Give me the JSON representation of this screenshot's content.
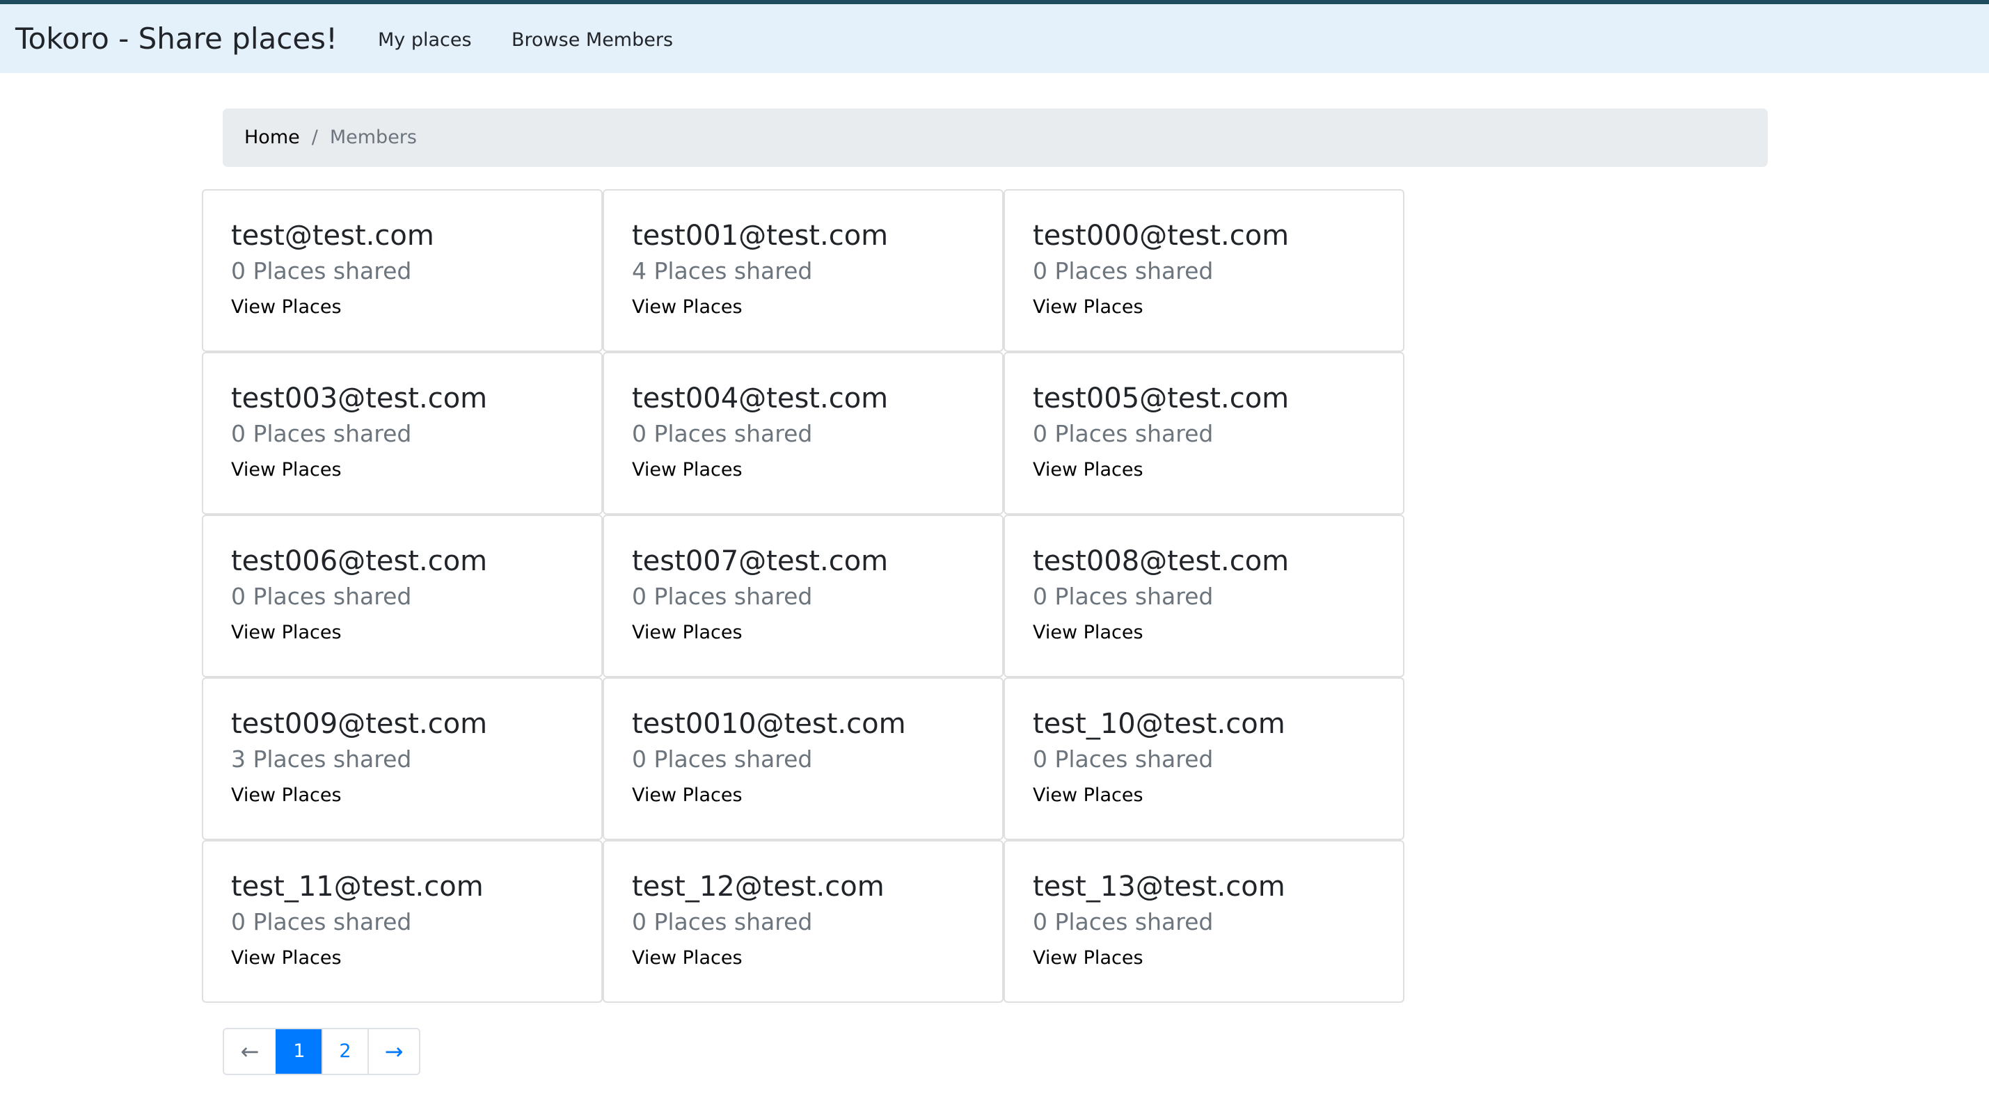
{
  "navbar": {
    "brand": "Tokoro - Share places!",
    "links": [
      "My places",
      "Browse Members"
    ]
  },
  "breadcrumb": {
    "home": "Home",
    "separator": "/",
    "current": "Members"
  },
  "members": [
    {
      "email": "test@test.com",
      "places": "0 Places shared",
      "link": "View Places"
    },
    {
      "email": "test001@test.com",
      "places": "4 Places shared",
      "link": "View Places"
    },
    {
      "email": "test000@test.com",
      "places": "0 Places shared",
      "link": "View Places"
    },
    {
      "email": "test003@test.com",
      "places": "0 Places shared",
      "link": "View Places"
    },
    {
      "email": "test004@test.com",
      "places": "0 Places shared",
      "link": "View Places"
    },
    {
      "email": "test005@test.com",
      "places": "0 Places shared",
      "link": "View Places"
    },
    {
      "email": "test006@test.com",
      "places": "0 Places shared",
      "link": "View Places"
    },
    {
      "email": "test007@test.com",
      "places": "0 Places shared",
      "link": "View Places"
    },
    {
      "email": "test008@test.com",
      "places": "0 Places shared",
      "link": "View Places"
    },
    {
      "email": "test009@test.com",
      "places": "3 Places shared",
      "link": "View Places"
    },
    {
      "email": "test0010@test.com",
      "places": "0 Places shared",
      "link": "View Places"
    },
    {
      "email": "test_10@test.com",
      "places": "0 Places shared",
      "link": "View Places"
    },
    {
      "email": "test_11@test.com",
      "places": "0 Places shared",
      "link": "View Places"
    },
    {
      "email": "test_12@test.com",
      "places": "0 Places shared",
      "link": "View Places"
    },
    {
      "email": "test_13@test.com",
      "places": "0 Places shared",
      "link": "View Places"
    }
  ],
  "pagination": {
    "prev": "←",
    "pages": [
      "1",
      "2"
    ],
    "active_page": "1",
    "next": "→"
  },
  "colors": {
    "navbar_bg": "#e4f1fb",
    "top_border": "#1f4d5e",
    "accent": "#007bff",
    "muted": "#6c757d"
  }
}
